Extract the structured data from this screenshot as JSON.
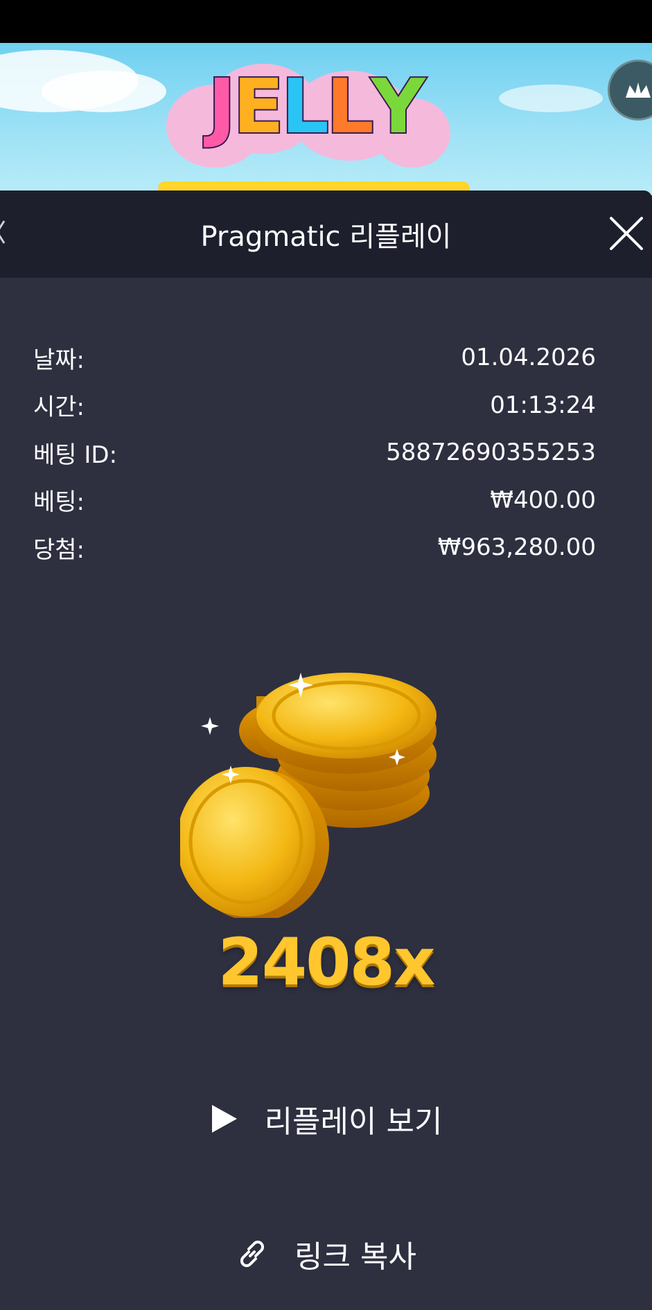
{
  "game": {
    "logo_text": [
      "J",
      "E",
      "L",
      "L",
      "Y"
    ]
  },
  "panel": {
    "title": "Pragmatic 리플레이"
  },
  "info": {
    "date_label": "날짜:",
    "date_value": "01.04.2026",
    "time_label": "시간:",
    "time_value": "01:13:24",
    "bet_id_label": "베팅 ID:",
    "bet_id_value": "58872690355253",
    "bet_label": "베팅:",
    "bet_value": "₩400.00",
    "win_label": "당첨:",
    "win_value": "₩963,280.00"
  },
  "result": {
    "multiplier": "2408x"
  },
  "actions": {
    "replay_label": "리플레이 보기",
    "copy_link_label": "링크 복사"
  },
  "icons": {
    "close": "close-icon",
    "play": "play-icon",
    "link": "link-icon",
    "coins": "gold-coins-icon",
    "corner": "crown-icon"
  },
  "colors": {
    "panel_bg": "#2e3040",
    "header_bg": "#1d1f2c",
    "multiplier": "#ffc62e",
    "text": "#ffffff"
  }
}
